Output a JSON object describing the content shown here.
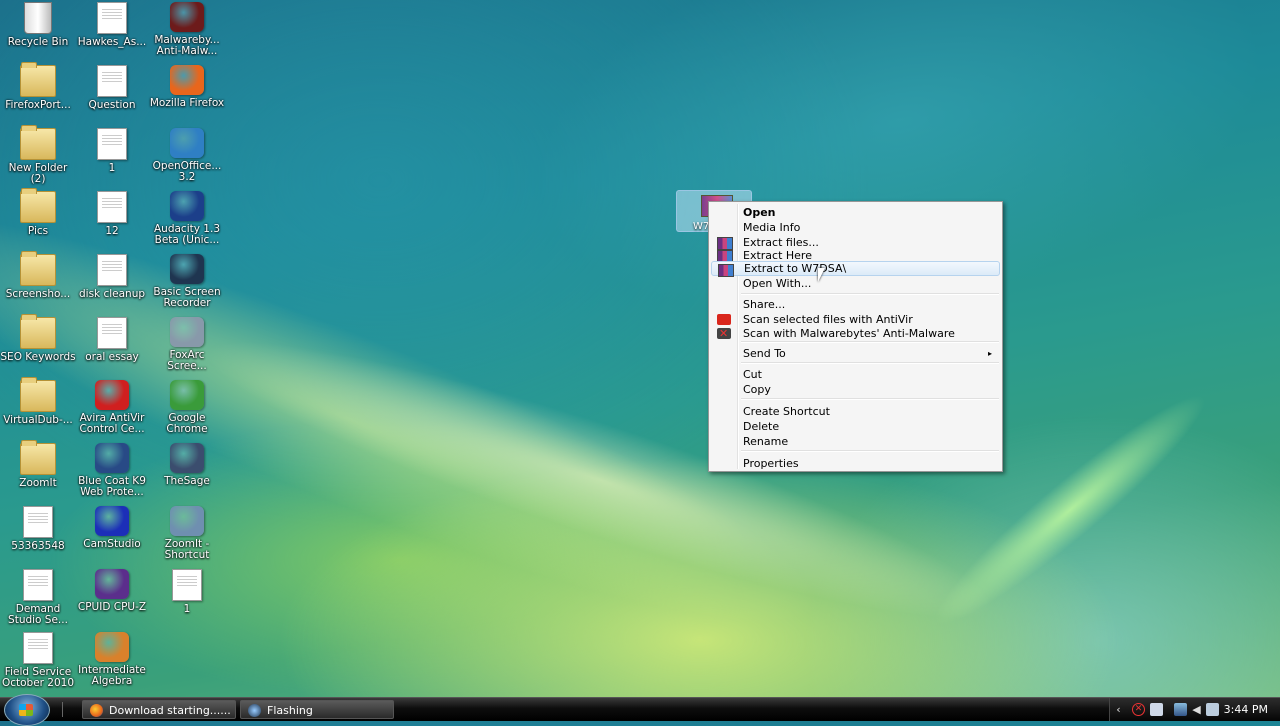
{
  "desktop": {
    "icons": [
      {
        "label": "Recycle Bin",
        "icon": "recycle-bin-icon",
        "kind": "bin"
      },
      {
        "label": "Hawkes_As...",
        "icon": "document-icon",
        "kind": "doc"
      },
      {
        "label": "Malwareby... Anti-Malw...",
        "icon": "malwarebytes-icon",
        "kind": "app",
        "color": "#6d1b1b"
      },
      {
        "label": "FirefoxPort...",
        "icon": "folder-icon",
        "kind": "folder"
      },
      {
        "label": "Question",
        "icon": "document-icon",
        "kind": "doc"
      },
      {
        "label": "Mozilla Firefox",
        "icon": "firefox-icon",
        "kind": "app",
        "color": "#e8661c"
      },
      {
        "label": "New Folder (2)",
        "icon": "folder-icon",
        "kind": "folder"
      },
      {
        "label": "1",
        "icon": "document-icon",
        "kind": "doc"
      },
      {
        "label": "OpenOffice... 3.2",
        "icon": "openoffice-icon",
        "kind": "app",
        "color": "#2f7fc4"
      },
      {
        "label": "Pics",
        "icon": "folder-icon",
        "kind": "folder"
      },
      {
        "label": "12",
        "icon": "document-icon",
        "kind": "doc"
      },
      {
        "label": "Audacity 1.3 Beta (Unic...",
        "icon": "audacity-icon",
        "kind": "app",
        "color": "#1c3f8a"
      },
      {
        "label": "Screensho...",
        "icon": "folder-icon",
        "kind": "folder"
      },
      {
        "label": "disk cleanup",
        "icon": "document-icon",
        "kind": "doc"
      },
      {
        "label": "Basic Screen Recorder",
        "icon": "screen-recorder-icon",
        "kind": "app",
        "color": "#1f3550"
      },
      {
        "label": "SEO Keywords",
        "icon": "folder-icon",
        "kind": "folder"
      },
      {
        "label": "oral essay",
        "icon": "document-icon",
        "kind": "doc"
      },
      {
        "label": "FoxArc Scree...",
        "icon": "foxarc-icon",
        "kind": "app",
        "color": "#8899aa"
      },
      {
        "label": "VirtualDub-...",
        "icon": "folder-icon",
        "kind": "folder"
      },
      {
        "label": "Avira AntiVir Control Ce...",
        "icon": "avira-icon",
        "kind": "app",
        "color": "#d01f1f"
      },
      {
        "label": "Google Chrome",
        "icon": "chrome-icon",
        "kind": "app",
        "color": "#3a9b3a"
      },
      {
        "label": "ZoomIt",
        "icon": "folder-icon",
        "kind": "folder"
      },
      {
        "label": "Blue Coat K9 Web Prote...",
        "icon": "k9-icon",
        "kind": "app",
        "color": "#284a86"
      },
      {
        "label": "TheSage",
        "icon": "thesage-icon",
        "kind": "app",
        "color": "#3b4d6e"
      },
      {
        "label": "53363548",
        "icon": "spreadsheet-icon",
        "kind": "doc"
      },
      {
        "label": "CamStudio",
        "icon": "camstudio-icon",
        "kind": "app",
        "color": "#1c2fb8"
      },
      {
        "label": "ZoomIt - Shortcut",
        "icon": "zoomit-icon",
        "kind": "app",
        "color": "#6f8fb0"
      },
      {
        "label": "Demand Studio Se...",
        "icon": "document-icon",
        "kind": "doc"
      },
      {
        "label": "CPUID CPU-Z",
        "icon": "cpuz-icon",
        "kind": "app",
        "color": "#5b2e8c"
      },
      {
        "label": "1",
        "icon": "avi-file-icon",
        "kind": "doc"
      },
      {
        "label": "Field Service October 2010",
        "icon": "document-icon",
        "kind": "doc"
      },
      {
        "label": "Intermediate Algebra",
        "icon": "algebra-icon",
        "kind": "app",
        "color": "#d9812b"
      }
    ],
    "selected_file": {
      "label": "W7",
      "icon": "winrar-archive-icon"
    }
  },
  "context_menu": {
    "items": [
      {
        "label": "Open",
        "bold": true
      },
      {
        "label": "Media Info"
      },
      {
        "label": "Extract files...",
        "icon": "winrar-icon"
      },
      {
        "label": "Extract Here",
        "icon": "winrar-icon"
      },
      {
        "label": "Extract to W7DSA\\",
        "icon": "winrar-icon",
        "highlighted": true
      },
      {
        "label": "Open With..."
      },
      {
        "label": "Share..."
      },
      {
        "label": "Scan selected files with AntiVir",
        "icon": "antivir-icon"
      },
      {
        "label": "Scan with Malwarebytes' Anti-Malware",
        "icon": "malwarebytes-icon"
      },
      {
        "label": "Send To",
        "submenu": true
      },
      {
        "label": "Cut"
      },
      {
        "label": "Copy"
      },
      {
        "label": "Create Shortcut"
      },
      {
        "label": "Delete"
      },
      {
        "label": "Rename"
      },
      {
        "label": "Properties"
      }
    ],
    "submenu_arrow": "▸"
  },
  "taskbar": {
    "buttons": [
      {
        "label": "Download starting......",
        "icon": "firefox-icon"
      },
      {
        "label": "Flashing",
        "icon": "screen-recorder-icon"
      }
    ],
    "tray": {
      "expand_arrow": "‹",
      "clock": "3:44 PM"
    }
  }
}
